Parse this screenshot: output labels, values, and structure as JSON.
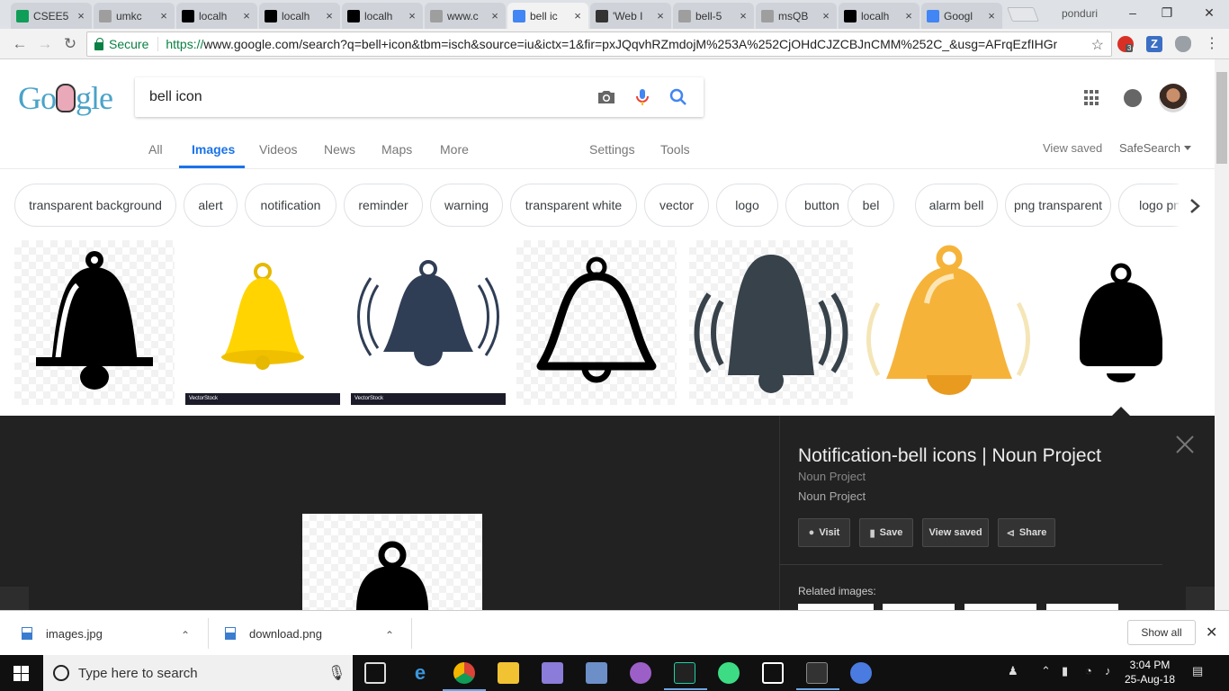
{
  "browser": {
    "tabs": [
      {
        "title": "CSEE5",
        "favicon": "sheets-icon",
        "color": "#0f9d58"
      },
      {
        "title": "umkc",
        "favicon": "page-icon",
        "color": "#9e9e9e"
      },
      {
        "title": "localh",
        "favicon": "webstorm-icon",
        "color": "#000000"
      },
      {
        "title": "localh",
        "favicon": "webstorm-icon",
        "color": "#000000"
      },
      {
        "title": "localh",
        "favicon": "webstorm-icon",
        "color": "#000000"
      },
      {
        "title": "www.c",
        "favicon": "page-icon",
        "color": "#9e9e9e"
      },
      {
        "title": "bell ic",
        "favicon": "google-icon",
        "color": "#4285f4",
        "active": true
      },
      {
        "title": "'Web I",
        "favicon": "github-icon",
        "color": "#333333"
      },
      {
        "title": "bell-5",
        "favicon": "page-icon",
        "color": "#9e9e9e"
      },
      {
        "title": "msQB",
        "favicon": "page-icon",
        "color": "#9e9e9e"
      },
      {
        "title": "localh",
        "favicon": "webstorm-icon",
        "color": "#000000"
      },
      {
        "title": "Googl",
        "favicon": "google-icon",
        "color": "#4285f4"
      }
    ],
    "profile_name": "ponduri",
    "security_label": "Secure",
    "url_scheme": "https://",
    "url_rest": "www.google.com/search?q=bell+icon&tbm=isch&source=iu&ictx=1&fir=pxJQqvhRZmdojM%253A%252CjOHdCJZCBJnCMM%252C_&usg=AFrqEzfIHGmip...",
    "extension_badge": "3"
  },
  "search": {
    "query": "bell icon",
    "tabs": [
      "All",
      "Images",
      "Videos",
      "News",
      "Maps",
      "More"
    ],
    "selected_tab": "Images",
    "settings_label": "Settings",
    "tools_label": "Tools",
    "view_saved_label": "View saved",
    "safesearch_label": "SafeSearch"
  },
  "chips": [
    "transparent background",
    "alert",
    "notification",
    "reminder",
    "warning",
    "transparent white",
    "vector",
    "logo",
    "button",
    "bel",
    "alarm bell",
    "png transparent",
    "logo png"
  ],
  "images": [
    {
      "name": "black-bell-stripe",
      "color": "#000000"
    },
    {
      "name": "yellow-bell",
      "color": "#ffd400",
      "watermark": "VectorStock"
    },
    {
      "name": "ringing-dark-bell",
      "color": "#2f3e55",
      "watermark": "VectorStock"
    },
    {
      "name": "outline-bell",
      "color": "#000000"
    },
    {
      "name": "ringing-slate-bell",
      "color": "#37424a"
    },
    {
      "name": "orange-bell",
      "color": "#f6b33a"
    },
    {
      "name": "solid-black-bell",
      "color": "#000000"
    }
  ],
  "panel": {
    "title": "Notification-bell icons | Noun Project",
    "site1": "Noun Project",
    "site2": "Noun Project",
    "buttons": {
      "visit": "Visit",
      "save": "Save",
      "view_saved": "View saved",
      "share": "Share"
    },
    "related_label": "Related images:"
  },
  "downloads": {
    "items": [
      "images.jpg",
      "download.png"
    ],
    "show_all": "Show all"
  },
  "taskbar": {
    "search_placeholder": "Type here to search",
    "time": "3:04 PM",
    "date": "25-Aug-18"
  }
}
